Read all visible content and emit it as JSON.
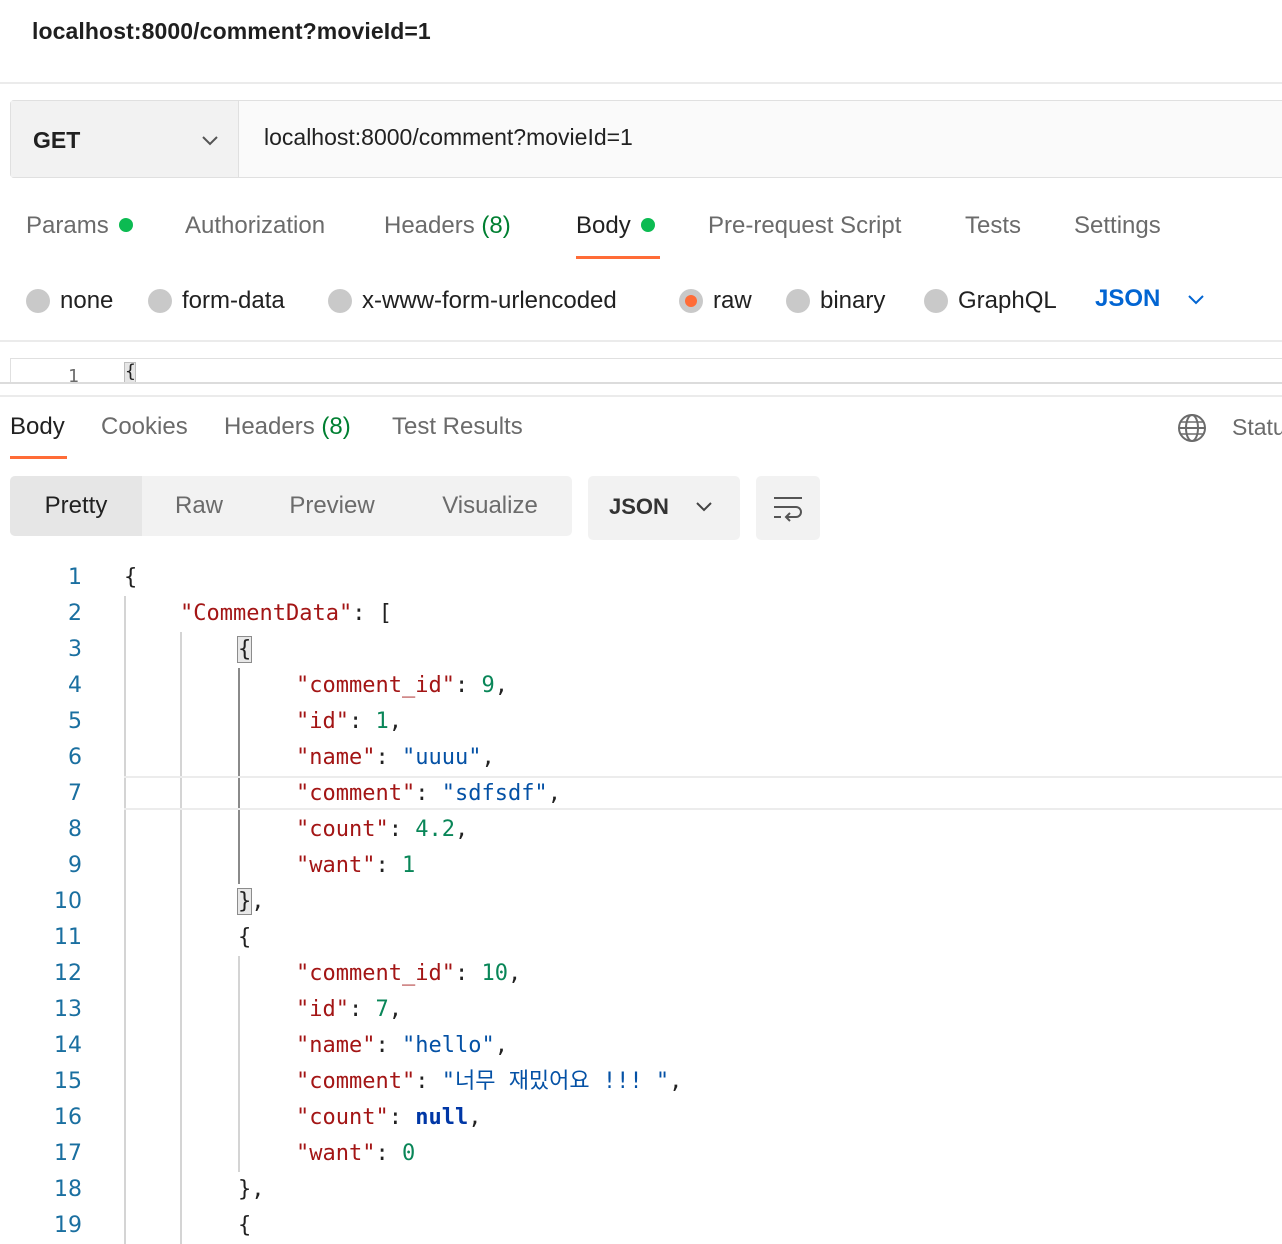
{
  "window": {
    "title": "localhost:8000/comment?movieId=1"
  },
  "request": {
    "method": "GET",
    "url": "localhost:8000/comment?movieId=1",
    "icons": {
      "method_dropdown": "chevron-down-icon"
    }
  },
  "request_tabs": [
    {
      "label": "Params",
      "dot": true
    },
    {
      "label": "Authorization"
    },
    {
      "label": "Headers",
      "count": "(8)"
    },
    {
      "label": "Body",
      "dot": true,
      "active": true
    },
    {
      "label": "Pre-request Script"
    },
    {
      "label": "Tests"
    },
    {
      "label": "Settings"
    }
  ],
  "body_types": [
    {
      "label": "none"
    },
    {
      "label": "form-data"
    },
    {
      "label": "x-www-form-urlencoded"
    },
    {
      "label": "raw",
      "selected": true
    },
    {
      "label": "binary"
    },
    {
      "label": "GraphQL"
    }
  ],
  "body_language": "JSON",
  "request_editor": {
    "line": "1",
    "text": "{"
  },
  "response_tabs": [
    {
      "label": "Body",
      "active": true
    },
    {
      "label": "Cookies"
    },
    {
      "label": "Headers",
      "count": "(8)"
    },
    {
      "label": "Test Results"
    }
  ],
  "response_status_label": "Status",
  "view_modes": [
    "Pretty",
    "Raw",
    "Preview",
    "Visualize"
  ],
  "active_view": "Pretty",
  "response_format": "JSON",
  "response_body_lines": [
    "{",
    "\"CommentData\": [",
    "{",
    "\"comment_id\": 9,",
    "\"id\": 1,",
    "\"name\": \"uuuu\",",
    "\"comment\": \"sdfsdf\",",
    "\"count\": 4.2,",
    "\"want\": 1",
    "},",
    "{",
    "\"comment_id\": 10,",
    "\"id\": 7,",
    "\"name\": \"hello\",",
    "\"comment\": \"너무 재밌어요 !!! \",",
    "\"count\": null,",
    "\"want\": 0",
    "},",
    "{"
  ],
  "colors": {
    "accent": "#ff6c37",
    "status_dot": "#0cbb52",
    "json_link": "#0265d2",
    "json_key": "#a31515",
    "json_string": "#0451a5",
    "json_number": "#098658",
    "json_keyword": "#0037a6"
  }
}
